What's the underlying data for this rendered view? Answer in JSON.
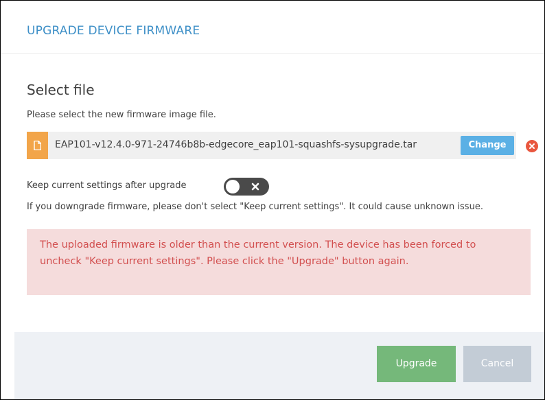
{
  "dialog": {
    "title": "UPGRADE DEVICE FIRMWARE"
  },
  "select_file": {
    "heading": "Select file",
    "instruction": "Please select the new firmware image file.",
    "file_name": "EAP101-v12.4.0-971-24746b8b-edgecore_eap101-squashfs-sysupgrade.tar",
    "file_icon": "file-icon",
    "change_label": "Change",
    "remove_icon": "close-circle-icon"
  },
  "keep_settings": {
    "label": "Keep current settings after upgrade",
    "enabled": false,
    "toggle_icon": "x-icon",
    "warning": "If you downgrade firmware, please don't select \"Keep current settings\". It could cause unknown issue."
  },
  "alert": {
    "message": "The uploaded firmware is older than the current version. The device has been forced to uncheck \"Keep current settings\". Please click the \"Upgrade\" button again."
  },
  "footer": {
    "upgrade_label": "Upgrade",
    "cancel_label": "Cancel"
  },
  "colors": {
    "title": "#3d8fc7",
    "change_button": "#5bb0e5",
    "file_icon_bg": "#f2a54a",
    "remove_icon": "#e9573f",
    "alert_bg": "#f5dcdc",
    "alert_text": "#d24f4f",
    "upgrade_button": "#75b87a",
    "cancel_button": "#c3ccd6",
    "footer_bg": "#eef1f5"
  }
}
